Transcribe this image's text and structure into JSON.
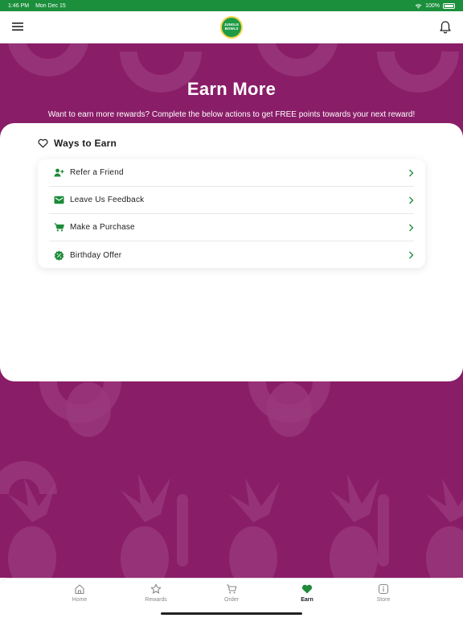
{
  "status_bar": {
    "time": "1:46 PM",
    "date": "Mon Dec 15",
    "battery": "100%"
  },
  "header": {
    "logo_line1": "JUNGLE",
    "logo_line2": "BOWLS",
    "menu_icon": "hamburger-icon",
    "bell_icon": "bell-icon"
  },
  "hero": {
    "title": "Earn More",
    "subtitle": "Want to earn more rewards? Complete the below actions to get FREE points towards your next reward!"
  },
  "ways": {
    "title": "Ways to Earn",
    "items": [
      {
        "label": "Refer a Friend",
        "icon": "add-user-icon"
      },
      {
        "label": "Leave Us Feedback",
        "icon": "mail-icon"
      },
      {
        "label": "Make a Purchase",
        "icon": "cart-icon"
      },
      {
        "label": "Birthday Offer",
        "icon": "badge-icon"
      }
    ]
  },
  "tabs": [
    {
      "label": "Home",
      "icon": "home-icon",
      "active": false
    },
    {
      "label": "Rewards",
      "icon": "star-icon",
      "active": false
    },
    {
      "label": "Order",
      "icon": "cart-icon",
      "active": false
    },
    {
      "label": "Earn",
      "icon": "heart-icon",
      "active": true
    },
    {
      "label": "Store",
      "icon": "info-icon",
      "active": false
    }
  ],
  "colors": {
    "brand_green": "#1b8f3c",
    "hero_purple": "#8a1d68",
    "icon_green": "#1e8a3a"
  }
}
